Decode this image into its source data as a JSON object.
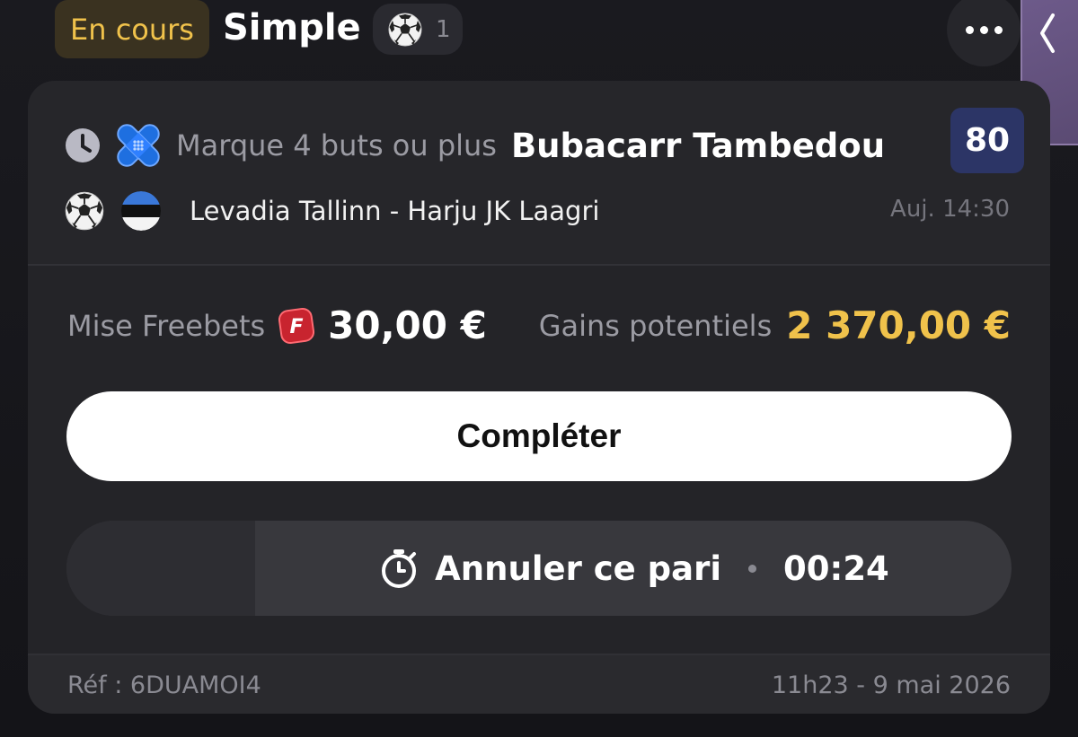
{
  "header": {
    "status": "En cours",
    "bet_type": "Simple",
    "sport_icon": "soccer-ball-icon",
    "selection_count": "1"
  },
  "selection": {
    "market": "Marque 4 buts ou plus",
    "player": "Bubacarr Tambedou",
    "odds": "80",
    "match": "Levadia Tallinn - Harju JK Laagri",
    "kickoff": "Auj. 14:30",
    "flag": "estonia-flag-icon"
  },
  "stake": {
    "label": "Mise Freebets",
    "value": "30,00 €"
  },
  "gains": {
    "label": "Gains potentiels",
    "value": "2 370,00 €"
  },
  "actions": {
    "complete_label": "Compléter",
    "cancel_label": "Annuler ce pari",
    "cancel_countdown": "00:24",
    "cancel_progress": 0.2
  },
  "footer": {
    "ref": "Réf : 6DUAMOI4",
    "placed_at": "11h23 - 9 mai 2026"
  },
  "colors": {
    "accent_gold": "#f0c24b",
    "odds_badge": "#2c3566",
    "card_bg": "#242428"
  }
}
